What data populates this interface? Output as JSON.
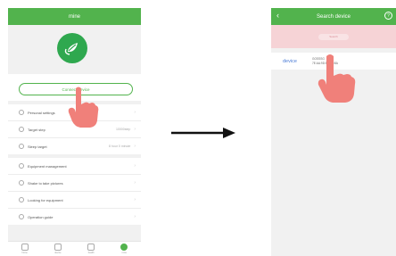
{
  "left_screen": {
    "title": "mine",
    "connect_button": "Connect device",
    "settings_group": [
      {
        "icon": "user-icon",
        "label": "Personal settings",
        "value": ""
      },
      {
        "icon": "footsteps-icon",
        "label": "Target step",
        "value": "10000step"
      },
      {
        "icon": "moon-icon",
        "label": "Sleep target",
        "value": "8 hour 0 minute"
      }
    ],
    "equipment_group": [
      {
        "icon": "gear-icon",
        "label": "Equipment management"
      },
      {
        "icon": "camera-icon",
        "label": "Shake to take pictures"
      },
      {
        "icon": "search-icon",
        "label": "Looking for equipment"
      },
      {
        "icon": "book-icon",
        "label": "Operation guide"
      }
    ],
    "tabs": [
      {
        "icon": "home-icon",
        "label": "home",
        "active": false
      },
      {
        "icon": "watch-icon",
        "label": "device",
        "active": false
      },
      {
        "icon": "heart-icon",
        "label": "health",
        "active": false
      },
      {
        "icon": "person-icon",
        "label": "mine",
        "active": true
      }
    ]
  },
  "right_screen": {
    "title": "Search device",
    "banner_text": "Search",
    "device_label": "device",
    "device_name": "GOSSSG",
    "device_mac": "7E:AA:9D:5B:6C:BA"
  },
  "colors": {
    "green": "#52b34d",
    "pink": "#f6d3d6",
    "hand": "#f0807a"
  }
}
